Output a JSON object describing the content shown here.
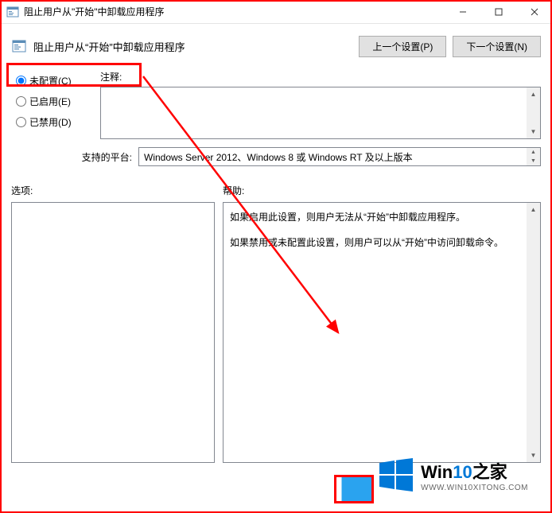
{
  "titlebar": {
    "title": "阻止用户从\"开始\"中卸载应用程序"
  },
  "header": {
    "title": "阻止用户从“开始”中卸载应用程序",
    "prev_btn": "上一个设置(P)",
    "next_btn": "下一个设置(N)"
  },
  "radios": {
    "not_configured": "未配置(C)",
    "enabled": "已启用(E)",
    "disabled": "已禁用(D)"
  },
  "comment": {
    "label": "注释:"
  },
  "platform": {
    "label": "支持的平台:",
    "value": "Windows Server 2012、Windows 8 或 Windows RT 及以上版本"
  },
  "options": {
    "label": "选项:"
  },
  "help": {
    "label": "帮助:",
    "para1": "如果启用此设置，则用户无法从“开始”中卸载应用程序。",
    "para2": "如果禁用或未配置此设置，则用户可以从“开始”中访问卸载命令。"
  },
  "watermark": {
    "main_a": "Win",
    "main_b": "10",
    "main_c": "之家",
    "sub": "WWW.WIN10XITONG.COM"
  }
}
